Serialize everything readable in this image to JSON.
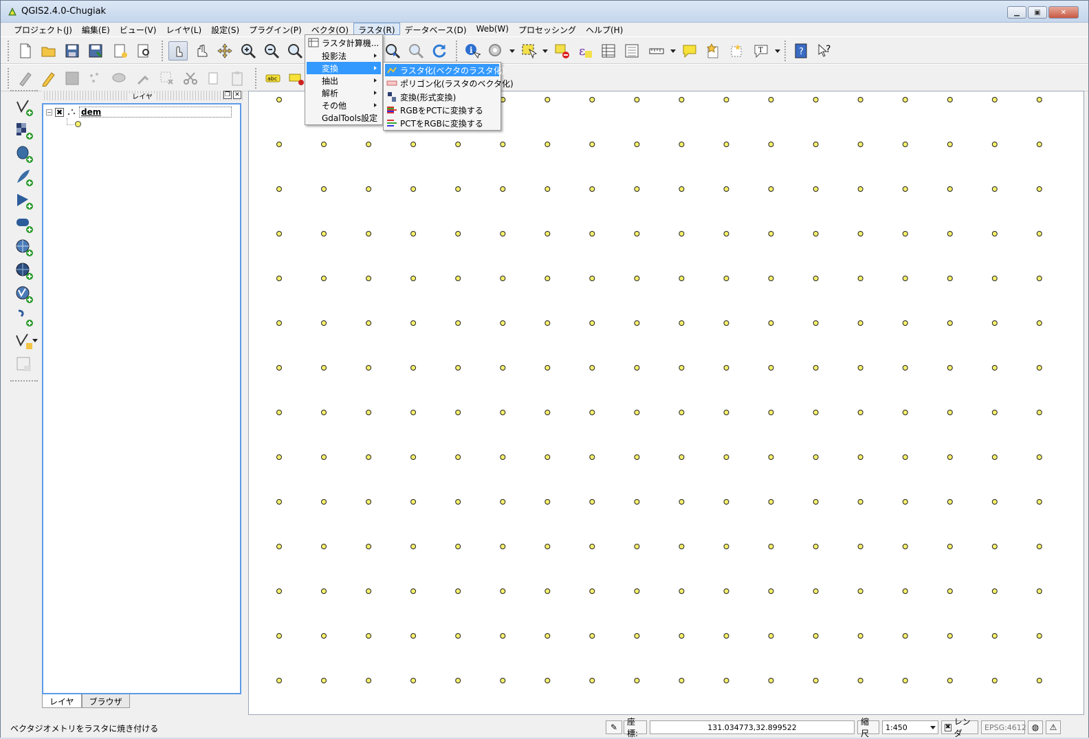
{
  "window": {
    "title": "QGIS2.4.0-Chugiak"
  },
  "menubar": [
    "プロジェクト(J)",
    "編集(E)",
    "ビュー(V)",
    "レイヤ(L)",
    "設定(S)",
    "プラグイン(P)",
    "ベクタ(O)",
    "ラスタ(R)",
    "データベース(D)",
    "Web(W)",
    "プロセッシング",
    "ヘルプ(H)"
  ],
  "raster_menu": {
    "items": [
      "ラスタ計算機...",
      "投影法",
      "変換",
      "抽出",
      "解析",
      "その他",
      "GdalTools設定"
    ]
  },
  "convert_submenu": {
    "items": [
      "ラスタ化(ベクタのラスタ化)",
      "ポリゴン化(ラスタのベクタ化)",
      "変換(形式変換)",
      "RGBをPCTに変換する",
      "PCTをRGBに変換する"
    ]
  },
  "layers_panel": {
    "title": "レイヤ",
    "layer_name": "dem",
    "tabs": [
      "レイヤ",
      "ブラウザ"
    ]
  },
  "map": {
    "point_fill": "#f6f06a",
    "columns": 18,
    "rows": 14
  },
  "statusbar": {
    "message": "ベクタジオメトリをラスタに焼き付ける",
    "coord_label": "座標:",
    "coord_value": "131.034773,32.899522",
    "scale_label": "縮尺",
    "scale_value": "1:450",
    "render_label": "レンダ",
    "crs": "EPSG:4612"
  }
}
